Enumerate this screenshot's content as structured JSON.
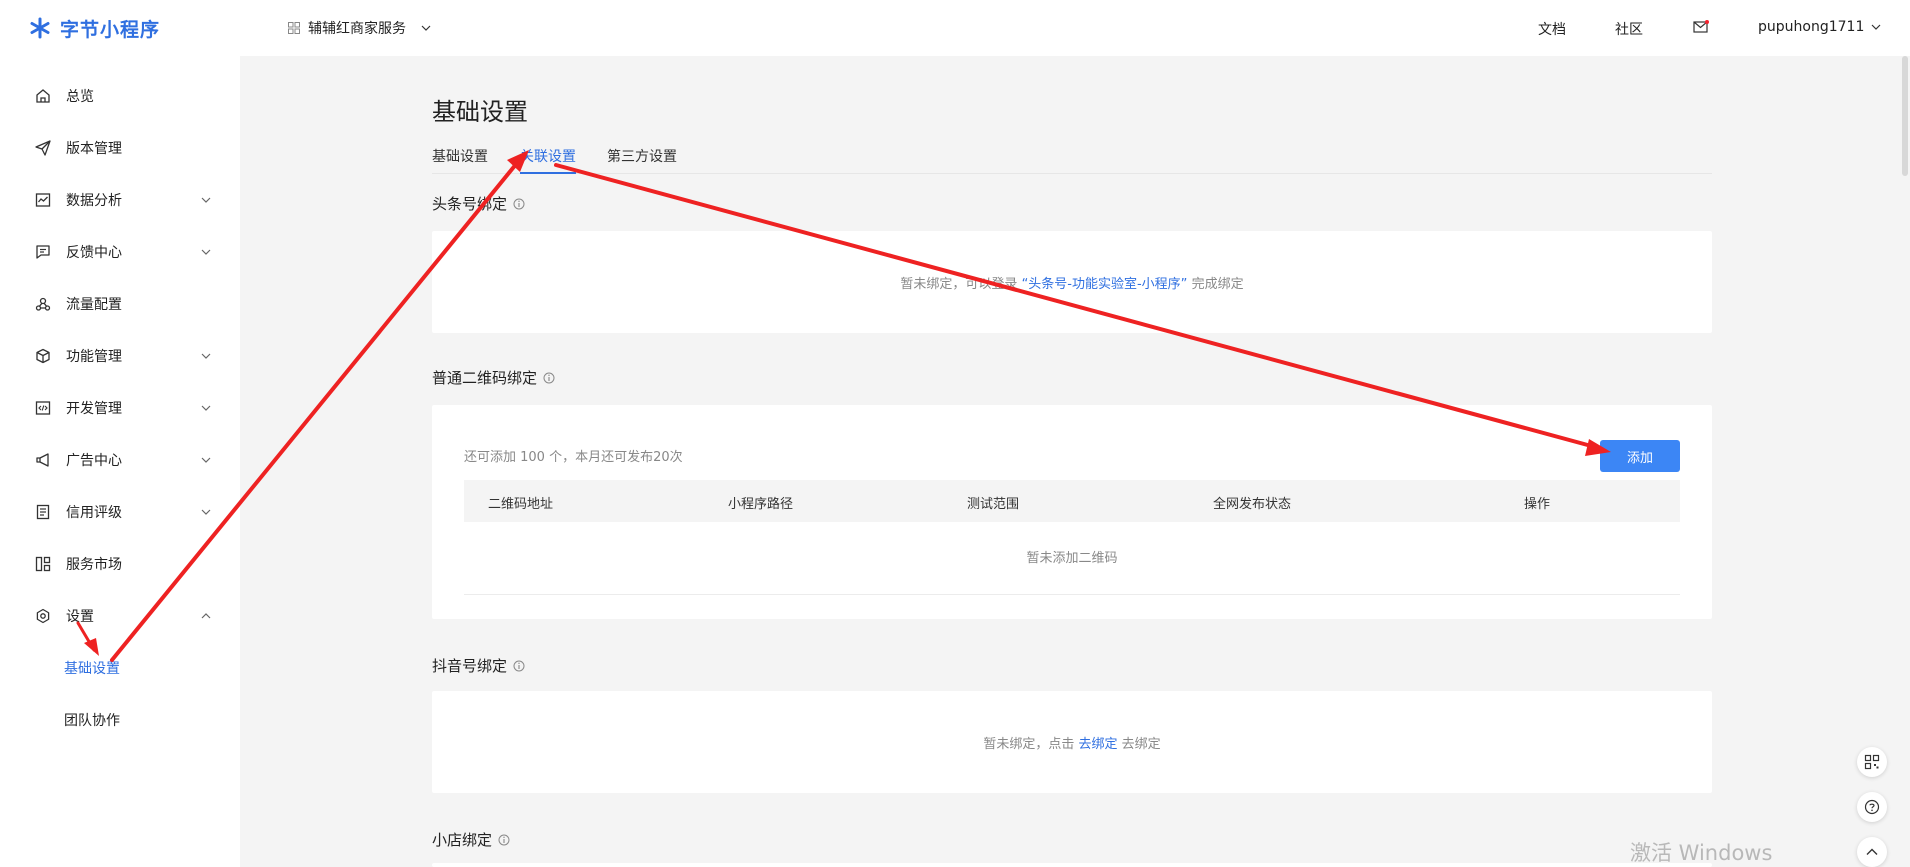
{
  "app": {
    "logo_text": "字节小程序"
  },
  "sidebar": {
    "items": [
      {
        "label": "总览",
        "icon": "home-icon",
        "expandable": false
      },
      {
        "label": "版本管理",
        "icon": "send-icon",
        "expandable": false
      },
      {
        "label": "数据分析",
        "icon": "chart-icon",
        "expandable": true
      },
      {
        "label": "反馈中心",
        "icon": "message-icon",
        "expandable": true
      },
      {
        "label": "流量配置",
        "icon": "traffic-icon",
        "expandable": false
      },
      {
        "label": "功能管理",
        "icon": "cube-icon",
        "expandable": true
      },
      {
        "label": "开发管理",
        "icon": "code-icon",
        "expandable": true
      },
      {
        "label": "广告中心",
        "icon": "megaphone-icon",
        "expandable": true
      },
      {
        "label": "信用评级",
        "icon": "document-icon",
        "expandable": true
      },
      {
        "label": "服务市场",
        "icon": "grid-icon",
        "expandable": false
      },
      {
        "label": "设置",
        "icon": "settings-icon",
        "expandable": true,
        "expanded": true
      }
    ],
    "sub_items": [
      {
        "label": "基础设置",
        "active": true
      },
      {
        "label": "团队协作",
        "active": false
      }
    ]
  },
  "topbar": {
    "merchant": "辅辅红商家服务",
    "docs": "文档",
    "community": "社区",
    "username": "pupuhong1711"
  },
  "main": {
    "title": "基础设置",
    "tabs": [
      {
        "label": "基础设置",
        "active": false
      },
      {
        "label": "关联设置",
        "active": true
      },
      {
        "label": "第三方设置",
        "active": false
      }
    ],
    "toutiao": {
      "title": "头条号绑定",
      "text_before": "暂未绑定，可以登录",
      "link": "“头条号-功能实验室-小程序”",
      "text_after": "完成绑定"
    },
    "qrcode": {
      "title": "普通二维码绑定",
      "quota": "还可添加 100 个，本月还可发布20次",
      "add_button": "添加",
      "columns": [
        "二维码地址",
        "小程序路径",
        "测试范围",
        "全网发布状态",
        "操作"
      ],
      "empty": "暂未添加二维码"
    },
    "douyin": {
      "title": "抖音号绑定",
      "text_before": "暂未绑定，点击",
      "link": "去绑定",
      "text_after": "去绑定"
    },
    "shop": {
      "title": "小店绑定"
    }
  },
  "watermark": "激活 Windows",
  "colors": {
    "accent": "#2f6fe0",
    "button": "#3c86f5",
    "arrow": "#ee2222"
  }
}
